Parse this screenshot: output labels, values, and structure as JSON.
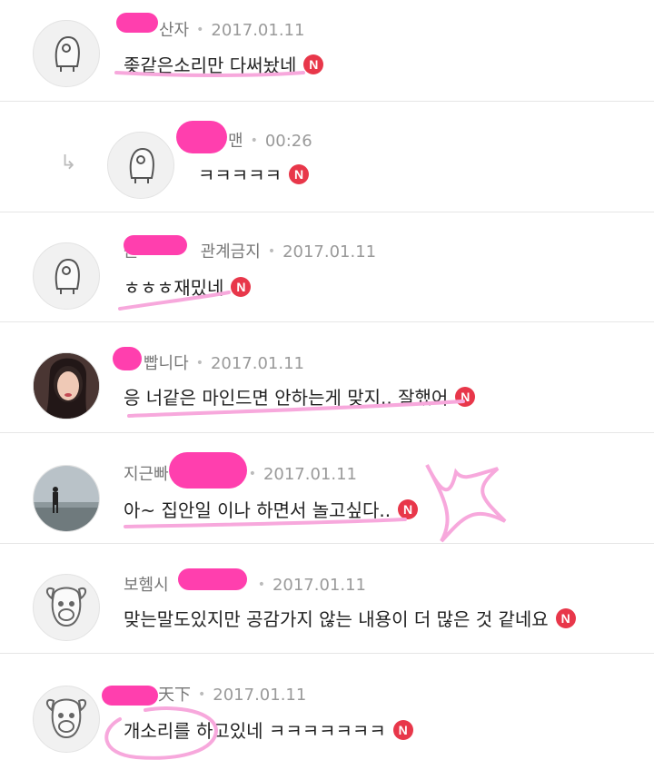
{
  "comments": [
    {
      "name": "산자",
      "date": "2017.01.11",
      "text": "좆같은소리만 다써놨네",
      "badge": "N"
    },
    {
      "name": "맨",
      "date": "00:26",
      "text": "ㅋㅋㅋㅋㅋ",
      "badge": "N"
    },
    {
      "name_prefix": "근",
      "name": "관계금지",
      "date": "2017.01.11",
      "text": "ㅎㅎㅎ재밌네",
      "badge": "N"
    },
    {
      "name": "빱니다",
      "date": "2017.01.11",
      "text": "응 너같은 마인드면 안하는게 맞지.. 잘했어",
      "badge": "N"
    },
    {
      "name": "지근빠",
      "date": "2017.01.11",
      "text": "아~ 집안일 이나 하면서 놀고싶다..",
      "badge": "N"
    },
    {
      "name": "보헴시",
      "date": "2017.01.11",
      "text": "맞는말도있지만 공감가지 않는 내용이 더 많은 것 같네요",
      "badge": "N"
    },
    {
      "name": "天下",
      "date": "2017.01.11",
      "text": "개소리를 하고있네 ㅋㅋㅋㅋㅋㅋㅋ",
      "badge": "N"
    }
  ],
  "colors": {
    "badge": "#e8374a",
    "highlight": "#ff3fae",
    "divider": "#e6e6e6"
  },
  "icons": {
    "reply": "reply-arrow-icon",
    "default_avatar": "default-avatar-icon",
    "dog_avatar": "dog-avatar-icon"
  }
}
